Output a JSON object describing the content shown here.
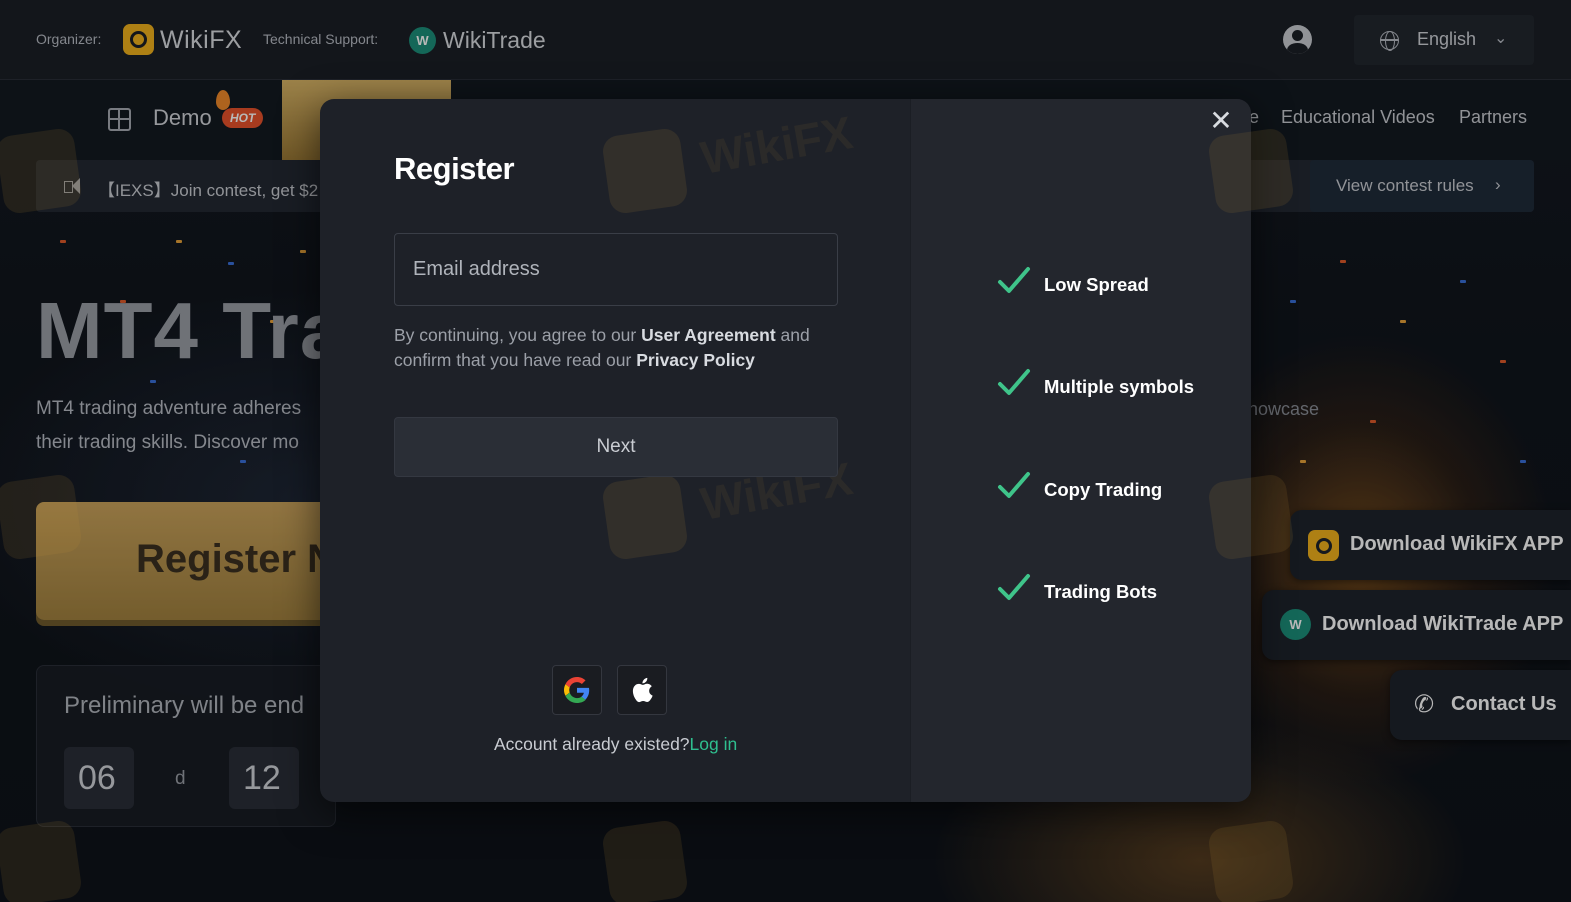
{
  "header": {
    "organizer_label": "Organizer:",
    "organizer_brand": "WikiFX",
    "support_label": "Technical Support:",
    "support_brand": "WikiTrade",
    "language": "English"
  },
  "nav": {
    "demo_label": "Demo",
    "hot_badge": "HOT",
    "partial_item": "e",
    "educational_videos": "Educational Videos",
    "partners": "Partners"
  },
  "contest_bar": {
    "text": "【IEXS】Join contest, get $2",
    "rules_label": "View contest rules"
  },
  "hero": {
    "title": "MT4 Tra",
    "desc_line1": "MT4 trading adventure adheres",
    "desc_line2": "their trading skills. Discover mo",
    "register_now": "Register N",
    "showcase": "howcase"
  },
  "countdown": {
    "label": "Preliminary will be end",
    "days": "06",
    "days_unit": "d",
    "hours": "12"
  },
  "floating": {
    "download_wikifx": "Download WikiFX APP",
    "download_wikitrade": "Download WikiTrade APP",
    "contact_us": "Contact Us"
  },
  "modal": {
    "title": "Register",
    "email_placeholder": "Email address",
    "agree_prefix": "By continuing, you agree to our ",
    "user_agreement": "User Agreement",
    "agree_mid": " and confirm that you have read our ",
    "privacy_policy": "Privacy Policy",
    "next_label": "Next",
    "account_existed": "Account already existed?",
    "login_link": "Log in",
    "features": [
      "Low Spread",
      "Multiple symbols",
      "Copy Trading",
      "Trading Bots"
    ]
  },
  "colors": {
    "accent_green": "#2fbf8f",
    "check_green": "#3fc48a",
    "wikifx_yellow": "#f2b21c",
    "wikitrade_teal": "#1d8f7a"
  },
  "icons": {
    "close": "close-icon",
    "google": "google-icon",
    "apple": "apple-icon",
    "check": "check-icon",
    "globe": "globe-icon",
    "user": "user-icon",
    "speaker": "speaker-icon",
    "phone": "phone-icon"
  }
}
